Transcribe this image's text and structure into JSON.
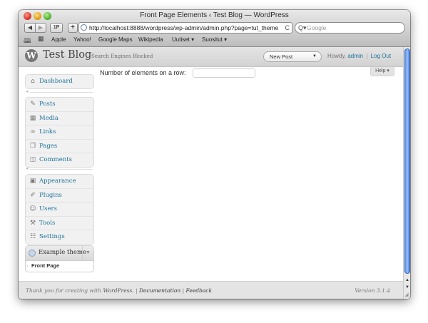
{
  "window": {
    "title": "Front Page Elements ‹ Test Blog — WordPress"
  },
  "toolbar": {
    "back": "◀",
    "forward": "▶",
    "onepassword": "1P",
    "add": "+",
    "url": "http://localhost:8888/wordpress/wp-admin/admin.php?page=tut_theme_settings",
    "reload": "C",
    "search_placeholder": "Google",
    "search_icon": "Q▾"
  },
  "bookmarks": [
    "Apple",
    "Yahoo!",
    "Google Maps",
    "Wikipedia",
    "Uutiset ▾",
    "Suositut ▾"
  ],
  "header": {
    "logo": "W",
    "site_title": "Test Blog",
    "visibility": "Search Engines Blocked",
    "favorite_action": "New Post",
    "favorite_arrow": "▼",
    "howdy": "Howdy,",
    "user": "admin",
    "separator": "|",
    "logout": "Log Out"
  },
  "menu": {
    "dashboard": [
      {
        "label": "Dashboard",
        "icon": "home-icon",
        "glyph": "⌂"
      }
    ],
    "content": [
      {
        "label": "Posts",
        "icon": "pin-icon",
        "glyph": "✎"
      },
      {
        "label": "Media",
        "icon": "media-icon",
        "glyph": "▦"
      },
      {
        "label": "Links",
        "icon": "link-icon",
        "glyph": "∞"
      },
      {
        "label": "Pages",
        "icon": "pages-icon",
        "glyph": "❐"
      },
      {
        "label": "Comments",
        "icon": "comment-icon",
        "glyph": "◫"
      }
    ],
    "admin": [
      {
        "label": "Appearance",
        "icon": "appearance-icon",
        "glyph": "▣"
      },
      {
        "label": "Plugins",
        "icon": "plugin-icon",
        "glyph": "✐"
      },
      {
        "label": "Users",
        "icon": "users-icon",
        "glyph": "☺"
      },
      {
        "label": "Tools",
        "icon": "tools-icon",
        "glyph": "⚒"
      },
      {
        "label": "Settings",
        "icon": "settings-icon",
        "glyph": "☷"
      }
    ],
    "separator_glyph": "◂",
    "theme": {
      "label": "Example theme",
      "toggle": "▼",
      "submenu": [
        {
          "label": "Front Page",
          "arrow": "›"
        }
      ]
    }
  },
  "content": {
    "field_label": "Number of elements on a row:",
    "field_value": "",
    "help": "Help ▾"
  },
  "footer": {
    "thanks": "Thank you for creating with",
    "wordpress": "WordPress.",
    "documentation": "Documentation",
    "feedback": "Feedback",
    "sep": "|",
    "version": "Version 3.1.4"
  },
  "scrollbar": {
    "up": "▲",
    "down": "▼",
    "resize": "◢"
  }
}
